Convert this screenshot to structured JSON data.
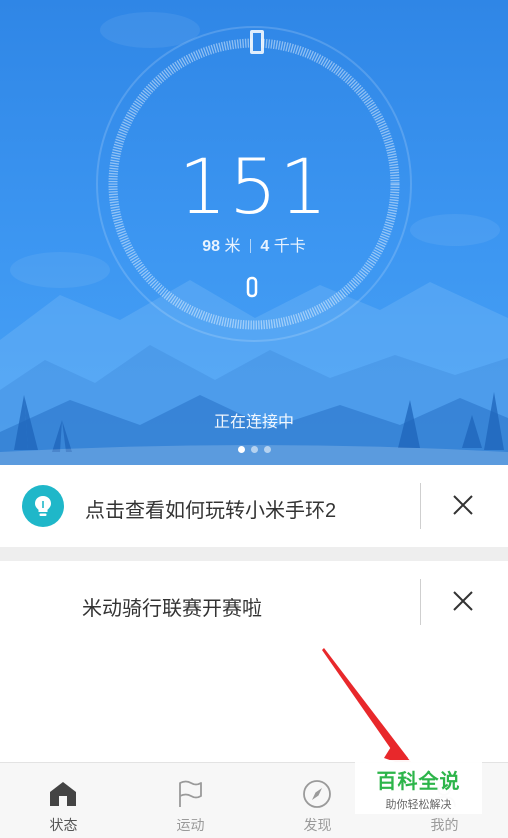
{
  "status": {
    "steps": "151",
    "distance_value": "98",
    "distance_unit": "米",
    "calorie_value": "4",
    "calorie_unit": "千卡",
    "connection": "正在连接中",
    "page_count": 3,
    "active_page": 0
  },
  "cards": [
    {
      "text": "点击查看如何玩转小米手环2",
      "icon": "lightbulb-icon"
    },
    {
      "text": "米动骑行联赛开赛啦"
    }
  ],
  "tabs": [
    {
      "label": "状态",
      "icon": "home-icon",
      "active": true
    },
    {
      "label": "运动",
      "icon": "flag-icon",
      "active": false
    },
    {
      "label": "发现",
      "icon": "compass-icon",
      "active": false
    },
    {
      "label": "我的",
      "icon": "profile-icon",
      "active": false
    }
  ],
  "watermark": {
    "title": "百科全说",
    "subtitle": "助你轻松解决"
  },
  "colors": {
    "hero_blue": "#3d97f2",
    "tip_teal": "#1fb7c9",
    "arrow_red": "#e8282b",
    "watermark_green": "#2db54a"
  }
}
